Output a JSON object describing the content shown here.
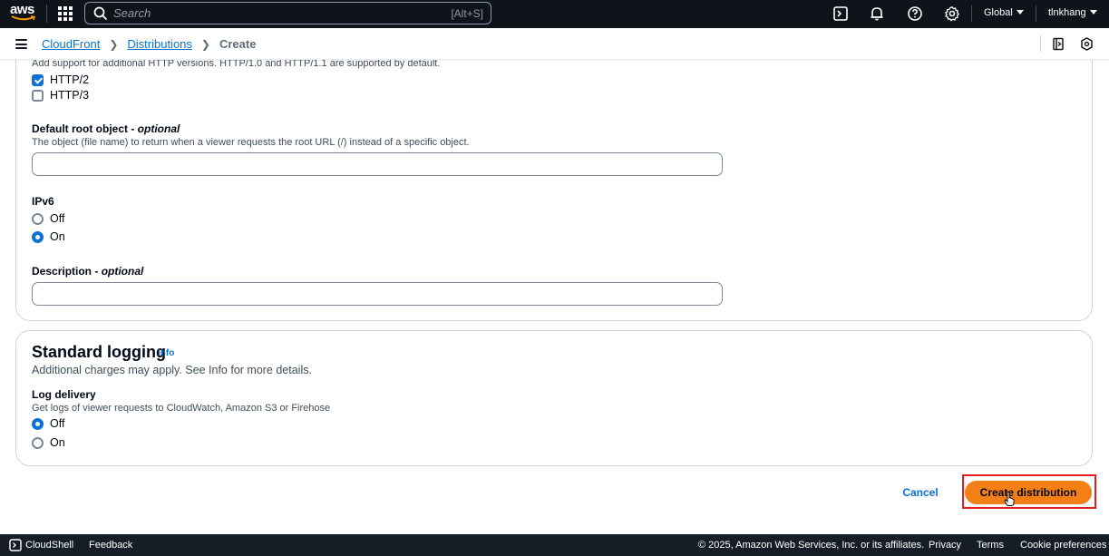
{
  "topnav": {
    "logo_text": "aws",
    "search_placeholder": "Search",
    "search_shortcut": "[Alt+S]",
    "region_label": "Global",
    "user_label": "tlnkhang",
    "icons": [
      "apps-grid-icon",
      "cloudshell-icon",
      "notifications-bell-icon",
      "help-icon",
      "settings-gear-icon"
    ]
  },
  "breadcrumb": {
    "items": [
      {
        "label": "CloudFront"
      },
      {
        "label": "Distributions"
      },
      {
        "label": "Create"
      }
    ]
  },
  "settings": {
    "http_versions_desc": "Add support for additional HTTP versions. HTTP/1.0 and HTTP/1.1 are supported by default.",
    "http2_label": "HTTP/2",
    "http2_checked": true,
    "http3_label": "HTTP/3",
    "http3_checked": false,
    "root_object_label": "Default root object - ",
    "root_object_optional": "optional",
    "root_object_desc": "The object (file name) to return when a viewer requests the root URL (/) instead of a specific object.",
    "root_object_value": "",
    "ipv6_label": "IPv6",
    "ipv6_off_label": "Off",
    "ipv6_on_label": "On",
    "ipv6_selected": "On",
    "description_label": "Description - ",
    "description_optional": "optional",
    "description_value": ""
  },
  "logging": {
    "title": "Standard logging",
    "info_link": "Info",
    "subtitle": "Additional charges may apply. See Info for more details.",
    "log_delivery_label": "Log delivery",
    "log_delivery_desc": "Get logs of viewer requests to CloudWatch, Amazon S3 or Firehose",
    "off_label": "Off",
    "on_label": "On",
    "selected": "Off"
  },
  "actions": {
    "cancel_label": "Cancel",
    "create_label": "Create distribution"
  },
  "footer": {
    "cloudshell_label": "CloudShell",
    "feedback_label": "Feedback",
    "copyright": "© 2025, Amazon Web Services, Inc. or its affiliates.",
    "privacy": "Privacy",
    "terms": "Terms",
    "cookie_prefs": "Cookie preferences"
  },
  "colors": {
    "nav_bg": "#0f141a",
    "link": "#0972d3",
    "primary_button": "#f57f17",
    "highlight_outline": "#e31b23",
    "footer_bg": "#161d26"
  }
}
